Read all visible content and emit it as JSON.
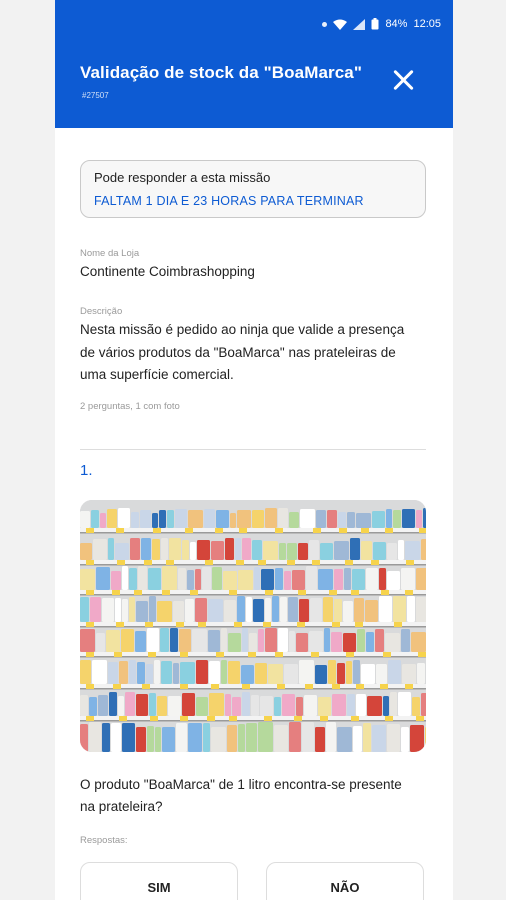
{
  "status_bar": {
    "battery": "84%",
    "time": "12:05"
  },
  "header": {
    "title": "Validação de stock da \"BoaMarca\"",
    "subtitle": "#27507",
    "close_icon": "close-icon",
    "color": "#0d5bd3"
  },
  "notice": {
    "line1": "Pode responder a esta missão",
    "line2": "FALTAM 1 DIA E 23 HORAS PARA TERMINAR"
  },
  "store": {
    "label": "Nome da Loja",
    "value": "Continente Coimbrashopping"
  },
  "description": {
    "label": "Descrição",
    "value": "Nesta missão é pedido ao ninja que valide a presença de vários produtos da \"BoaMarca\" nas prateleiras de uma superfície comercial."
  },
  "meta": "2 perguntas, 1 com foto",
  "question": {
    "number": "1.",
    "image_icon": "supermarket-shelf-photo",
    "text": "O produto \"BoaMarca\" de 1 litro encontra-se presente na prateleira?",
    "answers_label": "Respostas:",
    "answers": [
      "SIM",
      "NÃO"
    ]
  }
}
